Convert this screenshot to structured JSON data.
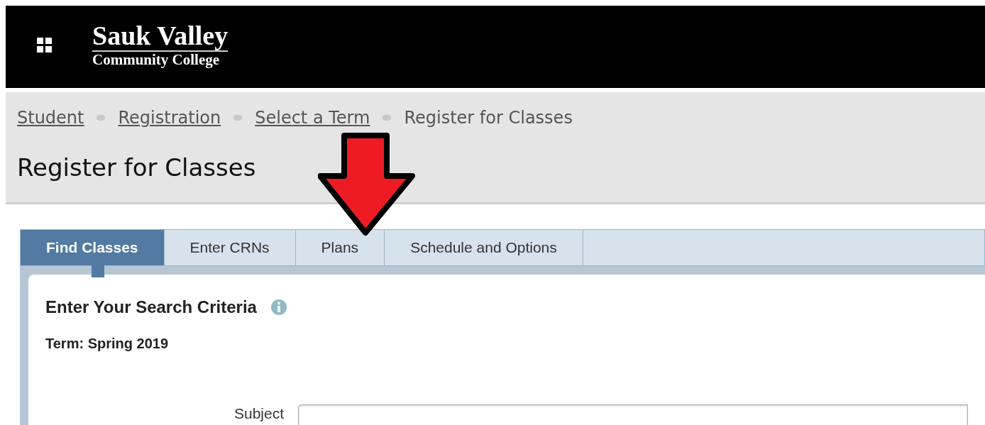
{
  "logo": {
    "name": "Sauk Valley",
    "subtitle": "Community College"
  },
  "breadcrumbs": [
    {
      "label": "Student",
      "link": true
    },
    {
      "label": "Registration",
      "link": true
    },
    {
      "label": "Select a Term",
      "link": true
    },
    {
      "label": "Register for Classes",
      "link": false
    }
  ],
  "page_title": "Register for Classes",
  "tabs": [
    {
      "label": "Find Classes",
      "selected": true
    },
    {
      "label": "Enter CRNs",
      "selected": false
    },
    {
      "label": "Plans",
      "selected": false
    },
    {
      "label": "Schedule and Options",
      "selected": false
    }
  ],
  "section": {
    "title": "Enter Your Search Criteria",
    "term": "Term: Spring 2019",
    "fields": [
      {
        "label": "Subject"
      }
    ]
  }
}
